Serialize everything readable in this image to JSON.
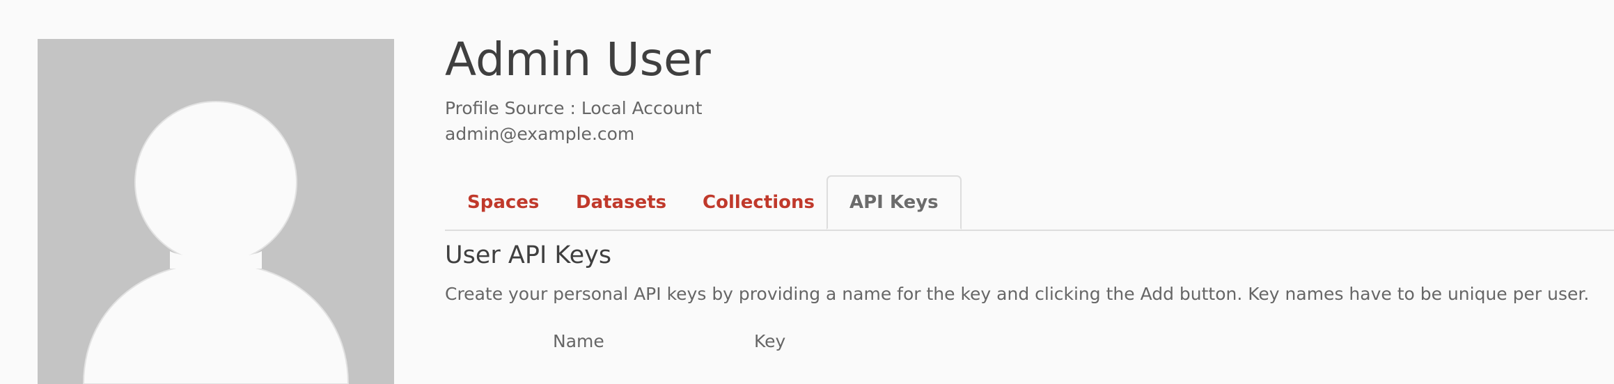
{
  "profile": {
    "name": "Admin User",
    "source": "Profile Source : Local Account",
    "email": "admin@example.com",
    "avatar_icon": "default-user-avatar-icon"
  },
  "tabs": [
    {
      "label": "Spaces",
      "active": false
    },
    {
      "label": "Datasets",
      "active": false
    },
    {
      "label": "Collections",
      "active": false
    },
    {
      "label": "API Keys",
      "active": true
    }
  ],
  "api_keys": {
    "title": "User API Keys",
    "description": "Create your personal API keys by providing a name for the key and clicking the Add button. Key names have to be unique per user.",
    "columns": [
      "Name",
      "Key"
    ]
  },
  "colors": {
    "link": "#c0392b",
    "active_tab_text": "#6b6b6b",
    "avatar_bg": "#c4c4c4",
    "avatar_fg": "#fafafa",
    "page_bg": "#fafafa"
  }
}
